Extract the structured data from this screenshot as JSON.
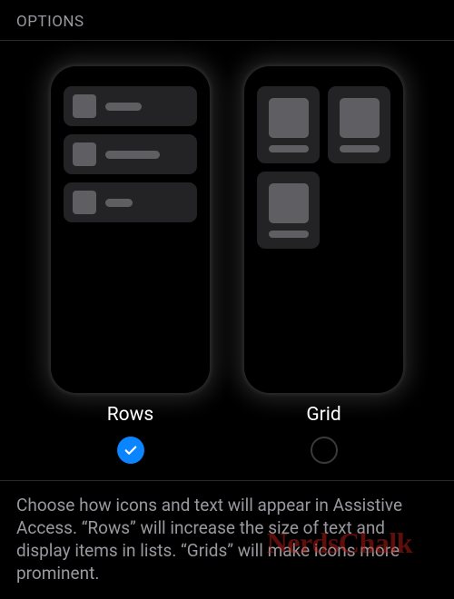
{
  "section_header": "OPTIONS",
  "options": {
    "rows": {
      "label": "Rows",
      "selected": true
    },
    "grid": {
      "label": "Grid",
      "selected": false
    }
  },
  "footer": "Choose how icons and text will appear in Assistive Access. “Rows” will increase the size of text and display items in lists. “Grids” will make icons more prominent.",
  "watermark": "NerdsChalk",
  "colors": {
    "accent": "#0a84ff"
  }
}
